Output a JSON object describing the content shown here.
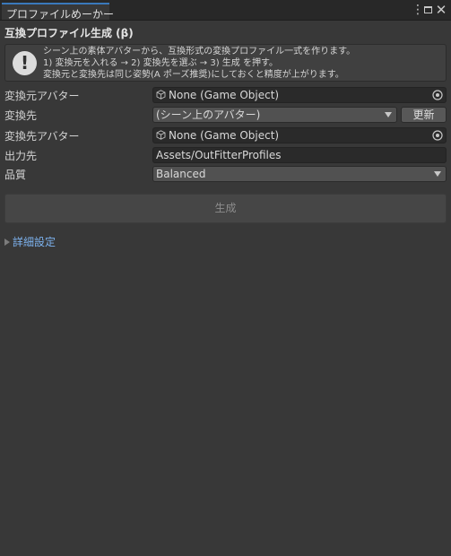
{
  "window": {
    "tab_title": "プロファイルめーかー",
    "menu_icon": "kebab-menu-icon",
    "maximize_icon": "maximize-icon",
    "close_icon": "close-icon"
  },
  "header": {
    "title": "互換プロファイル生成 (β)"
  },
  "help": {
    "icon": "info-icon",
    "lines": [
      "シーン上の素体アバターから、互換形式の変換プロファイル一式を作ります。",
      "1) 変換元を入れる → 2) 変換先を選ぶ → 3) 生成 を押す。",
      "変換元と変換先は同じ姿勢(A ポーズ推奨)にしておくと精度が上がります。"
    ]
  },
  "form": {
    "source_avatar": {
      "label": "変換元アバター",
      "value": "None (Game Object)"
    },
    "target": {
      "label": "変換先",
      "value": "(シーン上のアバター)",
      "refresh_label": "更新"
    },
    "target_avatar": {
      "label": "変換先アバター",
      "value": "None (Game Object)"
    },
    "output": {
      "label": "出力先",
      "value": "Assets/OutFitterProfiles"
    },
    "quality": {
      "label": "品質",
      "value": "Balanced"
    }
  },
  "actions": {
    "generate_label": "生成"
  },
  "advanced": {
    "label": "詳細設定"
  },
  "colors": {
    "background": "#383838",
    "tab_accent": "#3a79bb",
    "link": "#7cb1ec"
  }
}
